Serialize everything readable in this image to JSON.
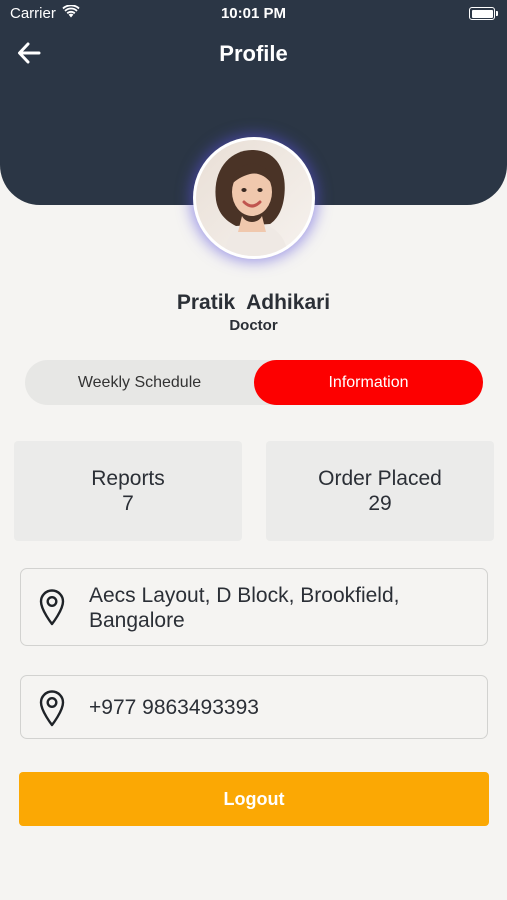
{
  "status_bar": {
    "carrier": "Carrier",
    "time": "10:01 PM"
  },
  "header": {
    "title": "Profile",
    "back_icon": "arrow-left-icon"
  },
  "profile": {
    "name": "Pratik  Adhikari",
    "role": "Doctor"
  },
  "tabs": [
    {
      "label": "Weekly Schedule",
      "active": false
    },
    {
      "label": "Information",
      "active": true
    }
  ],
  "stats": [
    {
      "label": "Reports",
      "value": "7"
    },
    {
      "label": "Order Placed",
      "value": "29"
    }
  ],
  "info": {
    "address": "Aecs Layout, D Block, Brookfield, Bangalore",
    "phone": "+977 9863493393",
    "icon": "location-pin-icon"
  },
  "actions": {
    "logout_label": "Logout"
  },
  "colors": {
    "header_bg": "#2b3645",
    "active_tab": "#fd0000",
    "logout": "#fba804",
    "page_bg": "#f5f4f2"
  }
}
